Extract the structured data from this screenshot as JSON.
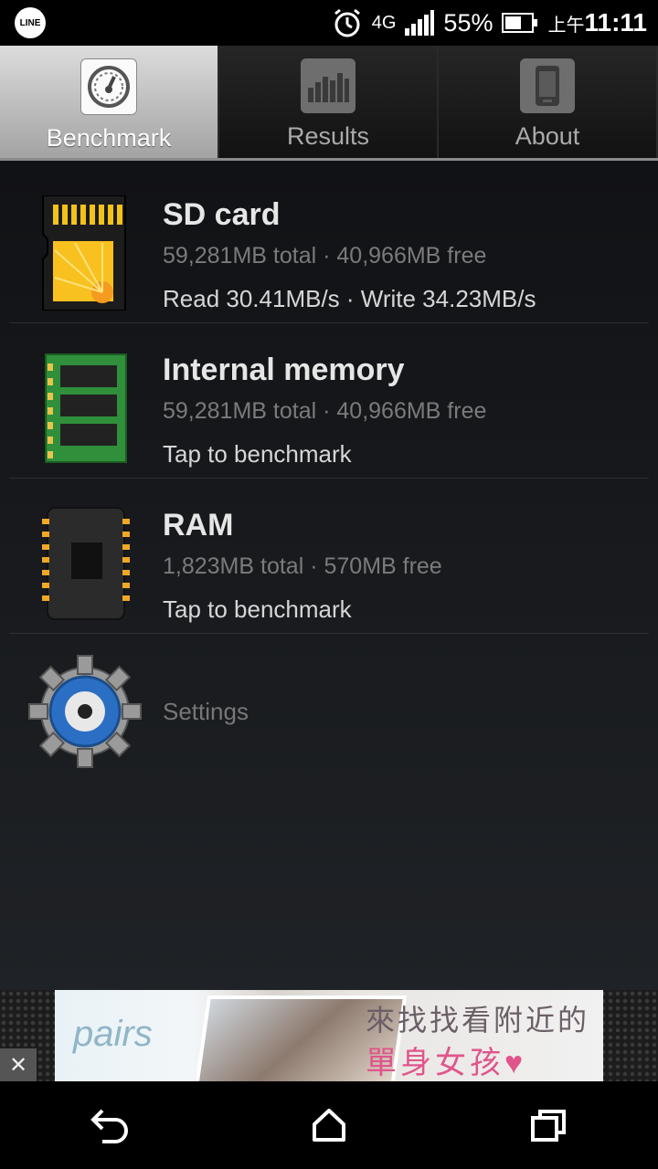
{
  "status_bar": {
    "line_label": "LINE",
    "network": "4G",
    "battery": "55%",
    "time_prefix": "上午",
    "time": "11:11",
    "icons": [
      "line-app-icon",
      "alarm-icon",
      "network-4g-icon",
      "signal-icon",
      "battery-icon"
    ]
  },
  "tabs": [
    {
      "label": "Benchmark",
      "icon": "speedometer-icon",
      "active": true
    },
    {
      "label": "Results",
      "icon": "bar-chart-icon",
      "active": false
    },
    {
      "label": "About",
      "icon": "phone-icon",
      "active": false
    }
  ],
  "items": [
    {
      "title": "SD card",
      "subtitle": "59,281MB total · 40,966MB free",
      "detail": "Read 30.41MB/s · Write 34.23MB/s",
      "icon": "sd-card-icon"
    },
    {
      "title": "Internal memory",
      "subtitle": "59,281MB total · 40,966MB free",
      "detail": "Tap to benchmark",
      "icon": "memory-module-icon"
    },
    {
      "title": "RAM",
      "subtitle": "1,823MB total · 570MB free",
      "detail": "Tap to benchmark",
      "icon": "ram-chip-icon"
    }
  ],
  "settings": {
    "label": "Settings",
    "icon": "settings-gear-icon"
  },
  "ad": {
    "brand": "pairs",
    "line1": "來找找看附近的",
    "line2": "單身女孩♥",
    "close": "✕"
  },
  "nav": [
    "back-icon",
    "home-icon",
    "recents-icon"
  ]
}
